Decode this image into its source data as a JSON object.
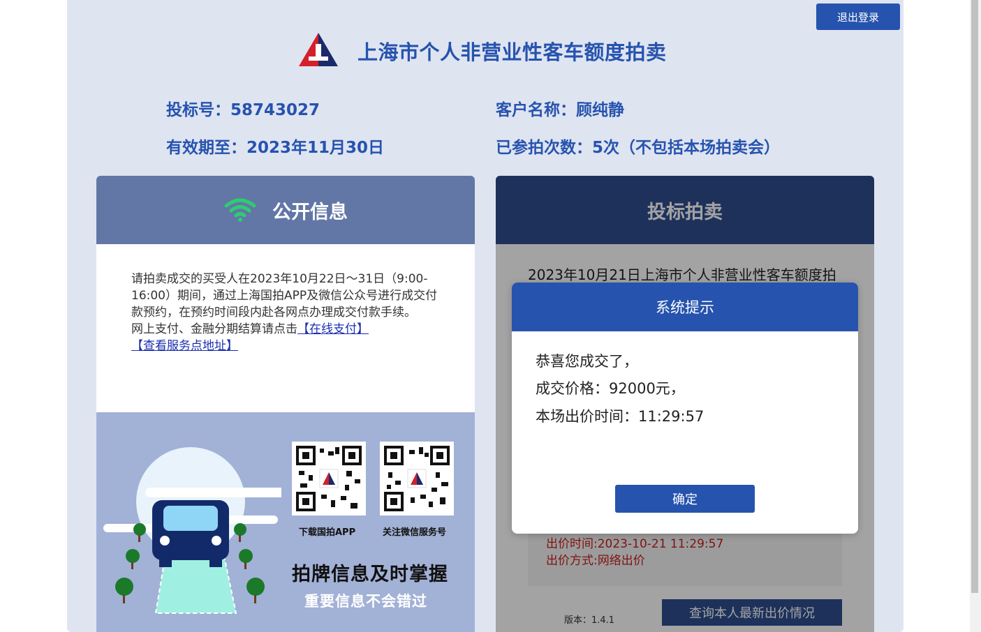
{
  "header": {
    "logout_label": "退出登录",
    "site_title": "上海市个人非营业性客车额度拍卖"
  },
  "user_info": {
    "bid_no_label": "投标号：",
    "bid_no": "58743027",
    "customer_label": "客户名称：",
    "customer_name": "顾纯静",
    "valid_label": "有效期至：",
    "valid_date": "2023年11月30日",
    "count_label": "已参拍次数：",
    "count_value": "5次（不包括本场拍卖会）"
  },
  "public_info": {
    "title": "公开信息",
    "notice_text": "请拍卖成交的买受人在2023年10月22日～31日（9:00-16:00）期间，通过上海国拍APP及微信公众号进行成交付款预约，在预约时间段内赴各网点办理成交付款手续。",
    "pay_prefix": "网上支付、金融分期结算请点击",
    "pay_link": "【在线支付】",
    "service_link": "【查看服务点地址】"
  },
  "promo": {
    "qr1_caption": "下载国拍APP",
    "qr2_caption": "关注微信服务号",
    "slogan_main": "拍牌信息及时掌握",
    "slogan_sub": "重要信息不会错过"
  },
  "bidding": {
    "title": "投标拍卖",
    "auction_text": "2023年10月21日上海市个人非营业性客车额度拍",
    "bid_time": "出价时间:2023-10-21 11:29:57",
    "bid_method": "出价方式:网络出价",
    "version": "版本：1.4.1",
    "query_button": "查询本人最新出价情况"
  },
  "modal": {
    "title": "系统提示",
    "line1": "恭喜您成交了，",
    "line2": "成交价格：92000元，",
    "line3": "本场出价时间：11:29:57",
    "ok_label": "确定"
  },
  "colors": {
    "brand_blue": "#2653ae",
    "panel_head_left": "#6277a6",
    "panel_head_right": "#2e4d8f",
    "sheet_bg": "#dfe4f1",
    "bid_red": "#c81e1e"
  },
  "icons": [
    "site-logo-icon",
    "wifi-icon",
    "car-illustration",
    "qr-code-app",
    "qr-code-wechat"
  ]
}
